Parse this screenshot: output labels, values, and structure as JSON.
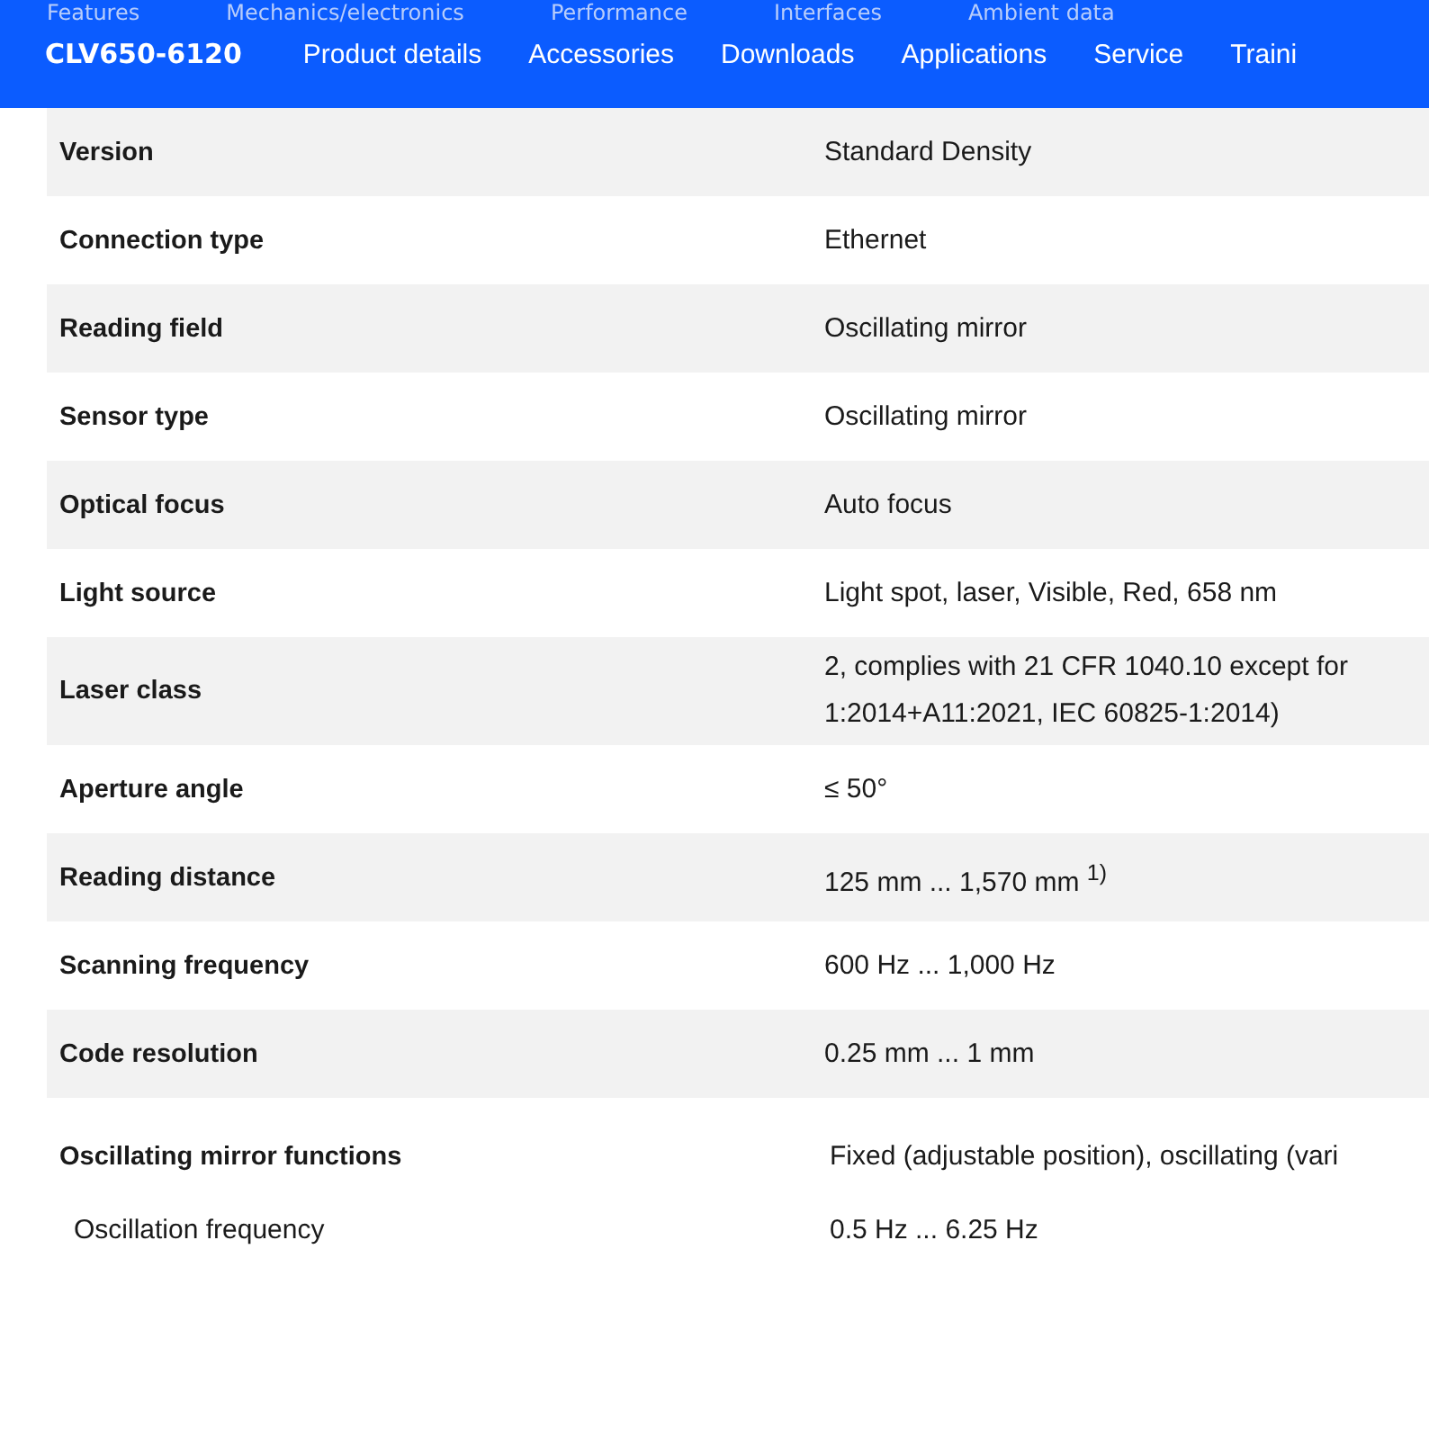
{
  "background_tabs": [
    "Features",
    "Mechanics/electronics",
    "Performance",
    "Interfaces",
    "Ambient data"
  ],
  "nav": {
    "product": "CLV650-6120",
    "links": [
      {
        "label": "Product details"
      },
      {
        "label": "Accessories"
      },
      {
        "label": "Downloads"
      },
      {
        "label": "Applications"
      },
      {
        "label": "Service"
      },
      {
        "label": "Traini"
      }
    ]
  },
  "specs": [
    {
      "label": "Version",
      "value": "Standard Density"
    },
    {
      "label": "Connection type",
      "value": "Ethernet"
    },
    {
      "label": "Reading field",
      "value": "Oscillating mirror"
    },
    {
      "label": "Sensor type",
      "value": "Oscillating mirror"
    },
    {
      "label": "Optical focus",
      "value": "Auto focus"
    },
    {
      "label": "Light source",
      "value": "Light spot, laser, Visible, Red, 658 nm"
    },
    {
      "label": "Laser class",
      "value": "2, complies with 21 CFR 1040.10 except for\n1:2014+A11:2021, IEC 60825-1:2014)"
    },
    {
      "label": "Aperture angle",
      "value": "≤ 50°"
    },
    {
      "label": "Reading distance",
      "value": "125 mm ... 1,570 mm $^{1)}$"
    },
    {
      "label": "Scanning frequency",
      "value": "600 Hz ... 1,000 Hz"
    },
    {
      "label": "Code resolution",
      "value": "0.25 mm ... 1 mm"
    }
  ],
  "mirror": {
    "label": "Oscillating mirror functions",
    "value": "Fixed (adjustable position), oscillating (vari",
    "sub": [
      {
        "label": "Oscillation frequency",
        "value": "0.5 Hz ... 6.25 Hz"
      }
    ]
  }
}
